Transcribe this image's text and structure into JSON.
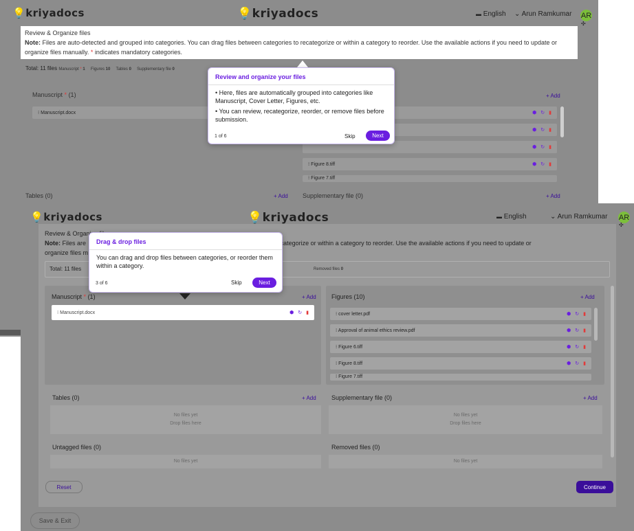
{
  "back": {
    "brand": "kriyadocs",
    "brand_center": "kriyadocs",
    "language": "English",
    "user_name": "Arun Ramkumar",
    "user_initials": "AR",
    "note_heading": "Review & Organize files",
    "note_label": "Note:",
    "note_text": "Files are auto-detected and grouped into categories. You can drag files between categories to recategorize or within a category to reorder. Use the available actions if you need to update or organize files manually.",
    "note_star": "*",
    "note_tail": "indicates mandatory categories.",
    "total_label": "Total: 11 files",
    "chips": [
      {
        "label": "Manuscript",
        "star": "*",
        "count": "1"
      },
      {
        "label": "Figures",
        "count": "10"
      },
      {
        "label": "Tables",
        "count": "0"
      },
      {
        "label": "Supplementary file",
        "count": "0"
      }
    ],
    "manuscript_title": "Manuscript",
    "manuscript_star": "*",
    "manuscript_count": "(1)",
    "manuscript_file": "Manuscript.docx",
    "add_label": "+ Add",
    "figure_files": [
      "",
      "",
      "",
      "Figure 8.tiff",
      "Figure 7.tiff"
    ],
    "tables_title": "Tables (0)",
    "supp_title": "Supplementary file (0)",
    "tour": {
      "title": "Review and organize your files",
      "bullet1": "Here, files are automatically grouped into categories like Manuscript, Cover Letter, Figures, etc.",
      "bullet2": "You can review, recategorize, reorder, or remove files before submission.",
      "counter": "1 of 6",
      "skip": "Skip",
      "next": "Next"
    }
  },
  "front": {
    "brand": "kriyadocs",
    "brand_center": "kriyadocs",
    "language": "English",
    "user_name": "Arun Ramkumar",
    "user_initials": "AR",
    "note_heading": "Review & Organize files",
    "note_label": "Note:",
    "note_start": "Files are",
    "note_text_right": "en categories to recategorize or within a category to reorder. Use the available actions if you need to update or",
    "note_line2": "organize files m",
    "total_label": "Total: 11 files",
    "removed_chip": "Removed files",
    "removed_count": "0",
    "manuscript_title": "Manuscript",
    "manuscript_star": "*",
    "manuscript_count": "(1)",
    "manuscript_file": "Manuscript.docx",
    "figures_title": "Figures (10)",
    "add_label": "+ Add",
    "figure_files": [
      "cover letter.pdf",
      "Approval of animal ethics review.pdf",
      "Figure 6.tiff",
      "Figure 8.tiff",
      "Figure 7.tiff"
    ],
    "tables_title": "Tables (0)",
    "supp_title": "Supplementary file (0)",
    "untagged_title": "Untagged files (0)",
    "removed_title": "Removed files (0)",
    "no_files": "No files yet",
    "drop_here": "Drop files here",
    "reset": "Reset",
    "continue": "Continue",
    "save_exit": "Save & Exit",
    "tour": {
      "title": "Drag & drop files",
      "body": "You can drag and drop files between categories, or reorder them within a category.",
      "counter": "3 of 6",
      "skip": "Skip",
      "next": "Next"
    }
  },
  "colors": {
    "accent": "#6a1ee0",
    "required": "#e23a3a",
    "avatar": "#7cbf3a"
  }
}
